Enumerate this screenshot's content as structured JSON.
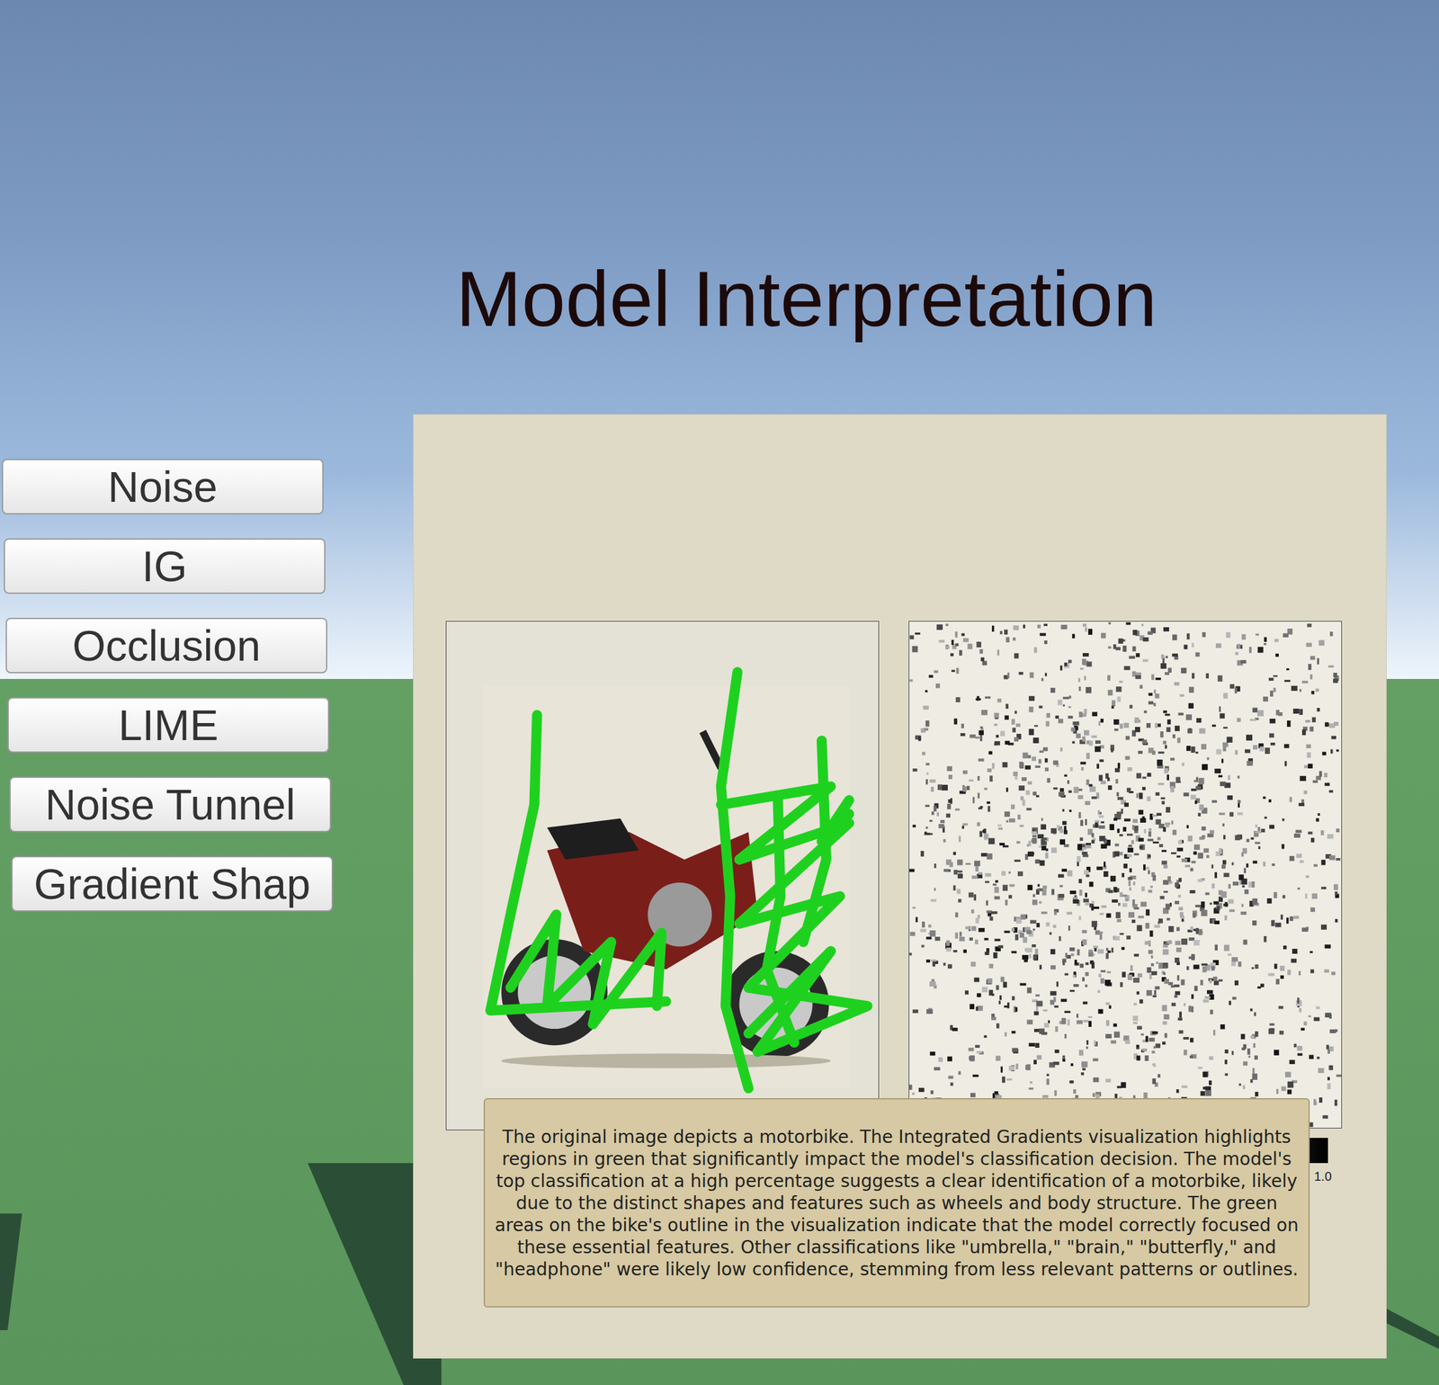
{
  "title": "Model Interpretation",
  "buttons": [
    {
      "label": "Noise"
    },
    {
      "label": "IG"
    },
    {
      "label": "Occlusion"
    },
    {
      "label": "LIME"
    },
    {
      "label": "Noise Tunnel"
    },
    {
      "label": "Gradient Shap"
    }
  ],
  "panel": {
    "description": "The original image depicts a motorbike. The Integrated Gradients visualization highlights regions in green that significantly impact the model's classification decision. The model's top classification at a high percentage suggests a clear identification of a motorbike, likely due to the distinct shapes and features such as wheels and body structure. The green areas on the bike's outline in the visualization indicate that the model correctly focused on these essential features. Other classifications like \"umbrella,\" \"brain,\" \"butterfly,\" and \"headphone\" were likely low confidence, stemming from less relevant patterns or outlines.",
    "colorbar": {
      "ticks": [
        "1.0"
      ]
    }
  }
}
